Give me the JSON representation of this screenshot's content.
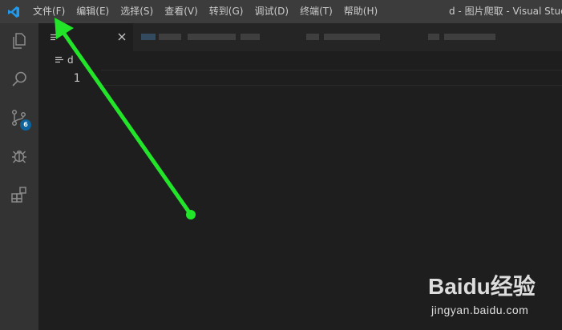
{
  "titlebar": {
    "logo_icon": "vscode-logo-icon",
    "menu": [
      {
        "label": "文件(F)"
      },
      {
        "label": "编辑(E)"
      },
      {
        "label": "选择(S)"
      },
      {
        "label": "查看(V)"
      },
      {
        "label": "转到(G)"
      },
      {
        "label": "调试(D)"
      },
      {
        "label": "终端(T)"
      },
      {
        "label": "帮助(H)"
      }
    ],
    "window_title": "d - 图片爬取 - Visual Studio"
  },
  "activitybar": {
    "items": [
      {
        "icon": "explorer-icon"
      },
      {
        "icon": "search-icon"
      },
      {
        "icon": "source-control-icon",
        "badge": "6"
      },
      {
        "icon": "debug-icon"
      },
      {
        "icon": "extensions-icon"
      }
    ]
  },
  "tabs": {
    "active": {
      "icon": "text-file-icon",
      "close_icon": "close-icon"
    }
  },
  "breadcrumb": {
    "icon": "text-file-icon",
    "label": "d"
  },
  "editor": {
    "lines": [
      {
        "number": "1",
        "text": ""
      }
    ]
  },
  "watermark": {
    "brand": "Baidu经验",
    "url": "jingyan.baidu.com"
  },
  "colors": {
    "titlebar": "#3c3c3c",
    "activitybar": "#333333",
    "editor": "#1e1e1e",
    "tabbar": "#252526",
    "badge": "#0e639c",
    "annotation_arrow": "#22e52a"
  }
}
